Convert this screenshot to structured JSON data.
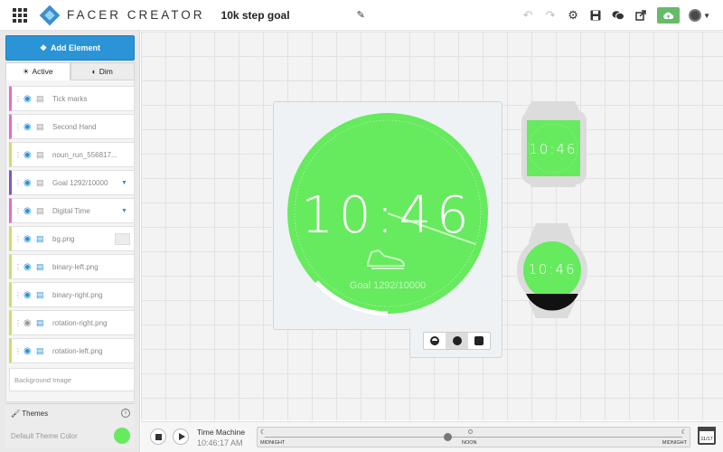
{
  "header": {
    "brand": "FACER CREATOR",
    "doc_title": "10k step goal",
    "icons": [
      "apps-grid-icon",
      "pencil-icon",
      "undo-icon",
      "redo-icon",
      "gear-icon",
      "save-icon",
      "chat-icon",
      "share-icon",
      "publish-cloud-icon",
      "avatar",
      "chevron-down-icon"
    ]
  },
  "sidebar": {
    "add_button": "Add Element",
    "tabs": [
      {
        "label": "Active",
        "icon": "sun-icon"
      },
      {
        "label": "Dim",
        "icon": "half-moon-icon"
      }
    ],
    "layers": [
      {
        "label": "Tick marks",
        "color": "#e86bc7",
        "kind": "shape",
        "visible": true
      },
      {
        "label": "Second Hand",
        "color": "#e86bc7",
        "kind": "shape",
        "visible": true
      },
      {
        "label": "noun_run_556817...",
        "color": "#c6e26a",
        "kind": "shape",
        "visible": true
      },
      {
        "label": "Goal 1292/10000",
        "color": "#7e57c2",
        "kind": "text",
        "visible": true
      },
      {
        "label": "Digital Time",
        "color": "#e86bc7",
        "kind": "text",
        "visible": true
      },
      {
        "label": "bg.png",
        "color": "#c6e26a",
        "kind": "image",
        "visible": true
      },
      {
        "label": "binary-left.png",
        "color": "#c6e26a",
        "kind": "image",
        "visible": true
      },
      {
        "label": "binary-right.png",
        "color": "#c6e26a",
        "kind": "image",
        "visible": true
      },
      {
        "label": "rotation-right.png",
        "color": "#c6e26a",
        "kind": "image",
        "visible": false
      },
      {
        "label": "rotation-left.png",
        "color": "#c6e26a",
        "kind": "image",
        "visible": true
      }
    ],
    "background_image": "Background Image",
    "themes": {
      "title": "Themes",
      "default_label": "Default Theme Color",
      "color": "#66ea5e"
    }
  },
  "watch": {
    "time": "10:46",
    "goal_text": "Goal 1292/10000",
    "face_color": "#66ea5e",
    "preview_time": "10:46"
  },
  "preview_modes": [
    "active-mode-icon",
    "dim-mode-icon",
    "square-mode-icon"
  ],
  "timeline": {
    "label": "Time Machine",
    "time": "10:46:17 AM",
    "ticks": [
      "MIDNIGHT",
      "NOON",
      "MIDNIGHT"
    ],
    "calendar_text": "11/17"
  }
}
